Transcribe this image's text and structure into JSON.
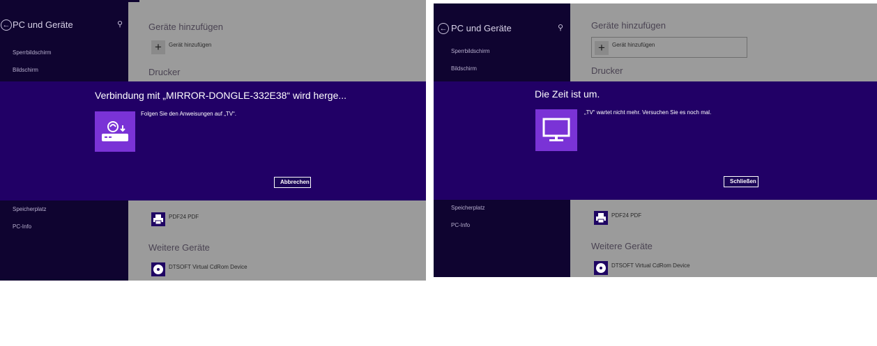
{
  "left": {
    "sidebar": {
      "title": "PC und Geräte",
      "items": [
        "Sperrbildschirm",
        "Bildschirm",
        "Speicherplatz",
        "PC-Info"
      ]
    },
    "content": {
      "add_section": "Geräte hinzufügen",
      "add_button": "Gerät hinzufügen",
      "printer_section": "Drucker",
      "printer_item": "PDF24 PDF",
      "other_section": "Weitere Geräte",
      "other_item": "DTSOFT Virtual CdRom Device"
    },
    "dialog": {
      "title": "Verbindung mit „MIRROR-DONGLE-332E38“ wird herge...",
      "message": "Folgen Sie den Anweisungen auf „TV“.",
      "button": "Abbrechen",
      "icon": "wireless-display-adapter-icon"
    }
  },
  "right": {
    "sidebar": {
      "title": "PC und Geräte",
      "items": [
        "Sperrbildschirm",
        "Bildschirm",
        "Speicherplatz",
        "PC-Info"
      ]
    },
    "content": {
      "add_section": "Geräte hinzufügen",
      "add_button": "Gerät hinzufügen",
      "printer_section": "Drucker",
      "printer_item": "PDF24 PDF",
      "other_section": "Weitere Geräte",
      "other_item": "DTSOFT Virtual CdRom Device"
    },
    "dialog": {
      "title": "Die Zeit ist um.",
      "message": "„TV“ wartet nicht mehr. Versuchen Sie es noch mal.",
      "button": "Schließen",
      "icon": "monitor-icon"
    }
  },
  "colors": {
    "sidebar_bg": "#0f0430",
    "overlay_bg": "#210066",
    "tile_bg": "#7a33d6",
    "content_dimmed": "#9b9b9b"
  }
}
